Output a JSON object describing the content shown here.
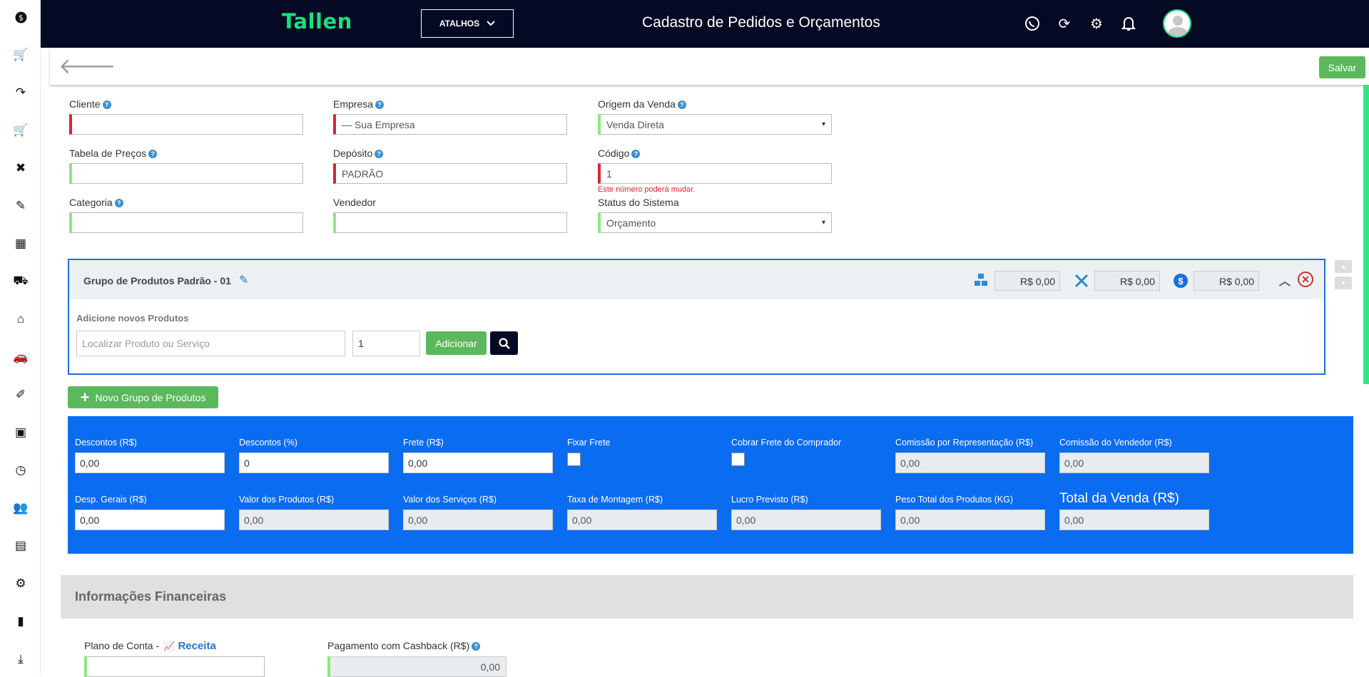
{
  "header": {
    "logo": "Tallen",
    "shortcuts_label": "ATALHOS",
    "title": "Cadastro de Pedidos e Orçamentos"
  },
  "toolbar": {
    "save_label": "Salvar"
  },
  "form": {
    "cliente": {
      "label": "Cliente",
      "value": ""
    },
    "empresa": {
      "label": "Empresa",
      "value": "— Sua Empresa"
    },
    "origem": {
      "label": "Origem da Venda",
      "value": "Venda Direta"
    },
    "tabela": {
      "label": "Tabela de Preços",
      "value": ""
    },
    "deposito": {
      "label": "Depósito",
      "value": "PADRÃO"
    },
    "codigo": {
      "label": "Código",
      "value": "1",
      "hint": "Este número poderá mudar."
    },
    "categoria": {
      "label": "Categoria",
      "value": ""
    },
    "vendedor": {
      "label": "Vendedor",
      "value": ""
    },
    "status": {
      "label": "Status do Sistema",
      "value": "Orçamento"
    }
  },
  "group": {
    "title": "Grupo de Produtos Padrão - 01",
    "total_products": "R$ 0,00",
    "total_services": "R$ 0,00",
    "total_general": "R$ 0,00",
    "add_label": "Adicione novos Produtos",
    "search_placeholder": "Localizar Produto ou Serviço",
    "quantity": "1",
    "add_button": "Adicionar"
  },
  "new_group_button": "Novo Grupo de Produtos",
  "totals": {
    "descontos_rs": {
      "label": "Descontos (R$)",
      "value": "0,00"
    },
    "descontos_pct": {
      "label": "Descontos (%)",
      "value": "0"
    },
    "frete": {
      "label": "Frete (R$)",
      "value": "0,00"
    },
    "fixar_frete": {
      "label": "Fixar Frete"
    },
    "cobrar_frete": {
      "label": "Cobrar Frete do Comprador"
    },
    "comissao_rep": {
      "label": "Comissão por Representação (R$)",
      "value": "0,00"
    },
    "comissao_vend": {
      "label": "Comissão do Vendedor (R$)",
      "value": "0,00"
    },
    "desp_gerais": {
      "label": "Desp. Gerais (R$)",
      "value": "0,00"
    },
    "valor_produtos": {
      "label": "Valor dos Produtos (R$)",
      "value": "0,00"
    },
    "valor_servicos": {
      "label": "Valor dos Serviços (R$)",
      "value": "0,00"
    },
    "taxa_montagem": {
      "label": "Taxa de Montagem (R$)",
      "value": "0,00"
    },
    "lucro_previsto": {
      "label": "Lucro Previsto (R$)",
      "value": "0,00"
    },
    "peso_total": {
      "label": "Peso Total dos Produtos (KG)",
      "value": "0,00"
    },
    "total_venda": {
      "label": "Total da Venda (R$)",
      "value": "0,00"
    }
  },
  "financial": {
    "title": "Informações Financeiras",
    "plano_label": "Plano de Conta -",
    "plano_link": "Receita",
    "cashback_label": "Pagamento com Cashback (R$)",
    "cashback_value": "0,00"
  }
}
